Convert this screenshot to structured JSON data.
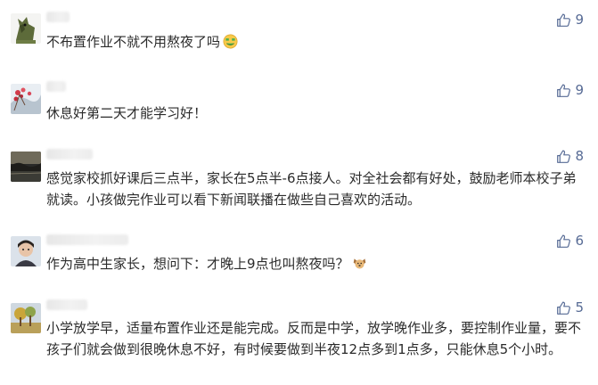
{
  "comments": [
    {
      "text": "不布置作业不就不用熬夜了吗",
      "likes": "9",
      "emoji": "money-mouth-face-emoji",
      "avatar": "green-animal-avatar"
    },
    {
      "text": "休息好第二天才能学习好！",
      "likes": "9",
      "emoji": "",
      "avatar": "red-flowers-avatar"
    },
    {
      "text": "感觉家校抓好课后三点半，家长在5点半-6点接人。对全社会都有好处，鼓励老师本校子弟就读。小孩做完作业可以看下新闻联播在做些自己喜欢的活动。",
      "likes": "8",
      "emoji": "",
      "avatar": "dark-landscape-avatar"
    },
    {
      "text": "作为高中生家长，想问下：才晚上9点也叫熬夜吗？",
      "likes": "6",
      "emoji": "dog-face-emoji",
      "avatar": "person-photo-avatar"
    },
    {
      "text": "小学放学早，适量布置作业还是能完成。反而是中学，放学晚作业多，要控制作业量，要不孩子们就会做到很晚休息不好，有时候要做到半夜12点多到1点多，只能休息5个小时。",
      "likes": "5",
      "emoji": "",
      "avatar": "tree-scene-avatar"
    }
  ],
  "colors": {
    "like": "#576b95",
    "text": "#2b2b2b"
  }
}
